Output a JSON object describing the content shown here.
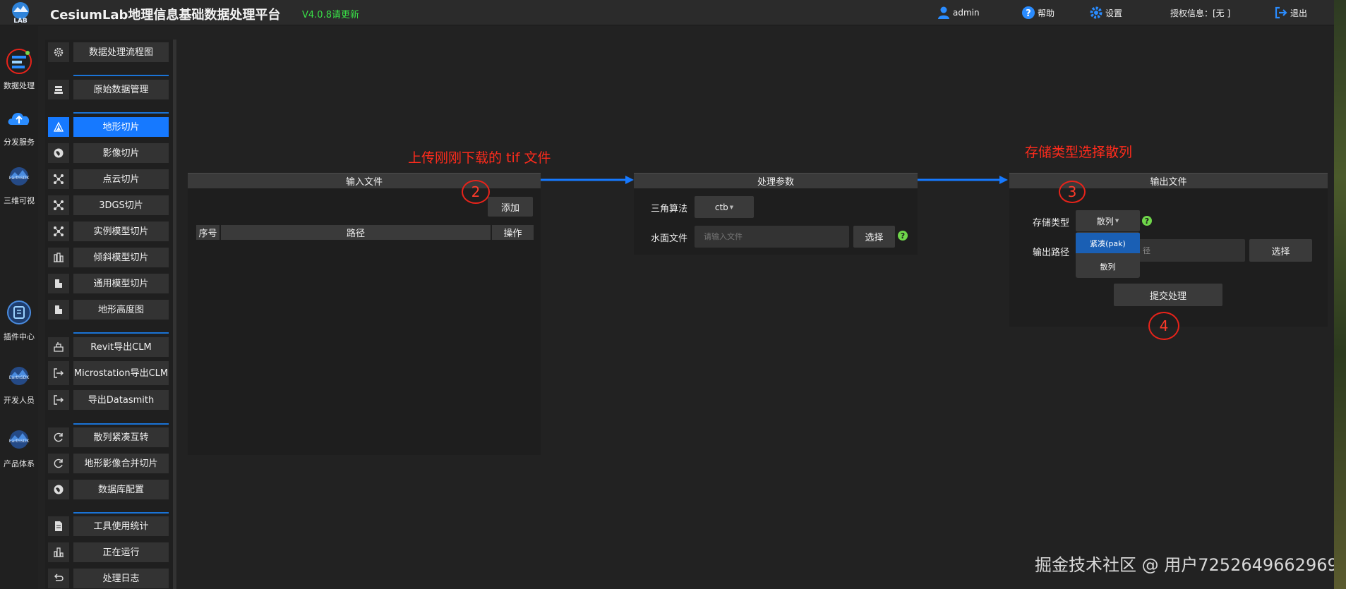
{
  "header": {
    "title": "CesiumLab地理信息基础数据处理平台",
    "version": "V4.0.8请更新",
    "user": "admin",
    "help": "帮助",
    "settings": "设置",
    "license": "授权信息：[无 ]",
    "logout": "退出",
    "logo_text": "LAB"
  },
  "rail": {
    "items": [
      {
        "label": "数据处理",
        "icon": "data-processing-icon"
      },
      {
        "label": "分发服务",
        "icon": "cloud-icon"
      },
      {
        "label": "三维可视",
        "icon": "earthsdk-icon"
      },
      {
        "label": "插件中心",
        "icon": "plugin-icon"
      },
      {
        "label": "开发人员",
        "icon": "earthsdk-icon"
      },
      {
        "label": "产品体系",
        "icon": "earthsdk-icon"
      }
    ]
  },
  "sidebar": {
    "items": [
      {
        "label": "数据处理流程图",
        "icon": "gear-icon"
      },
      {
        "label": "原始数据管理",
        "icon": "database-icon"
      },
      {
        "label": "地形切片",
        "icon": "terrain-icon"
      },
      {
        "label": "影像切片",
        "icon": "globe-icon"
      },
      {
        "label": "点云切片",
        "icon": "nodes-icon"
      },
      {
        "label": "3DGS切片",
        "icon": "nodes-icon"
      },
      {
        "label": "实例模型切片",
        "icon": "nodes-icon"
      },
      {
        "label": "倾斜模型切片",
        "icon": "buildings-icon"
      },
      {
        "label": "通用模型切片",
        "icon": "building-icon"
      },
      {
        "label": "地形高度图",
        "icon": "building-icon"
      },
      {
        "label": "Revit导出CLM",
        "icon": "revit-icon"
      },
      {
        "label": "Microstation导出CLM",
        "icon": "export-icon"
      },
      {
        "label": "导出Datasmith",
        "icon": "export-icon"
      },
      {
        "label": "散列紧凑互转",
        "icon": "refresh-icon"
      },
      {
        "label": "地形影像合并切片",
        "icon": "refresh-icon"
      },
      {
        "label": "数据库配置",
        "icon": "globe-icon"
      },
      {
        "label": "工具使用统计",
        "icon": "document-icon"
      },
      {
        "label": "正在运行",
        "icon": "bar-chart-icon"
      },
      {
        "label": "处理日志",
        "icon": "undo-icon"
      }
    ]
  },
  "input_panel": {
    "title": "输入文件",
    "add_button": "添加",
    "columns": [
      "序号",
      "路径",
      "操作"
    ]
  },
  "params_panel": {
    "title": "处理参数",
    "algorithm_label": "三角算法",
    "algorithm_value": "ctb",
    "water_label": "水面文件",
    "water_placeholder": "请输入文件",
    "select_button": "选择",
    "help": "?"
  },
  "output_panel": {
    "title": "输出文件",
    "storage_label": "存储类型",
    "storage_value": "散列",
    "output_path_label": "输出路径",
    "output_path_partial": "径",
    "select_button": "选择",
    "submit_button": "提交处理",
    "help": "?",
    "dropdown_options": [
      "紧凑(pak)",
      "散列"
    ]
  },
  "annotations": {
    "upload_note": "上传刚刚下载的 tif 文件",
    "storage_note": "存储类型选择散列",
    "step2": "2",
    "step3": "3",
    "step4": "4"
  },
  "watermark": "掘金技术社区 @ 用户7252649662969",
  "colors": {
    "accent": "#1679ff",
    "annotation": "#ff2b1c",
    "version": "#39e047",
    "help": "#6fd64a"
  }
}
